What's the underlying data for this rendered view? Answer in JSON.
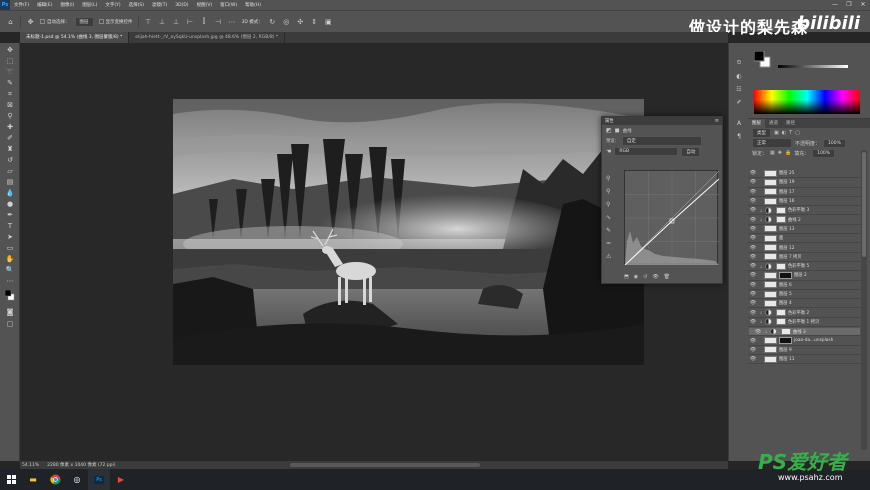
{
  "menu": {
    "app_logo": "Ps",
    "items": [
      "文件(F)",
      "编辑(E)",
      "图像(I)",
      "图层(L)",
      "文字(Y)",
      "选择(S)",
      "滤镜(T)",
      "3D(D)",
      "视图(V)",
      "窗口(W)",
      "帮助(H)"
    ],
    "window_controls": [
      "—",
      "❐",
      "✕"
    ]
  },
  "options": {
    "auto_select_label": "自动选择：",
    "auto_select_value": "图层",
    "show_transform_label": "显示变换控件",
    "mode_3d_label": "3D 模式："
  },
  "watermark": {
    "text": "做设计的梨先森",
    "brand": "bilibili"
  },
  "tabs": [
    {
      "label": "未标题-1.psd @ 54.1% (曲线 3, 图层蒙版/8) *",
      "active": true
    },
    {
      "label": "elijah-hiett-_rV_oySqkU-unsplash.jpg @ 48.6% (图层 2, RGB/8) *",
      "active": false
    }
  ],
  "status": {
    "zoom": "54.11%",
    "doc_info": "2280 像素 x 1040 像素 (72 ppi)"
  },
  "properties": {
    "title": "属性",
    "type_label": "曲线",
    "preset_label": "预设：",
    "preset_value": "自定",
    "channel_value": "RGB",
    "auto_button": "自动"
  },
  "layers": {
    "tabs": [
      "图层",
      "通道",
      "路径"
    ],
    "kind_filter": "类型",
    "blend_mode": "正常",
    "opacity_label": "不透明度：",
    "opacity_value": "100%",
    "lock_label": "锁定：",
    "fill_label": "填充：",
    "fill_value": "100%",
    "items": [
      {
        "name": "图层 25",
        "kind": "pixel",
        "selected": false
      },
      {
        "name": "图层 19",
        "kind": "pixel",
        "selected": false
      },
      {
        "name": "图层 17",
        "kind": "pixel",
        "selected": false
      },
      {
        "name": "图层 16",
        "kind": "pixel",
        "selected": false
      },
      {
        "name": "色彩平衡 3",
        "kind": "adj",
        "selected": false
      },
      {
        "name": "曲线 2",
        "kind": "adj",
        "selected": false
      },
      {
        "name": "图层 13",
        "kind": "pixel",
        "selected": false
      },
      {
        "name": "鹿",
        "kind": "pixel",
        "selected": false
      },
      {
        "name": "图层 12",
        "kind": "pixel",
        "selected": false
      },
      {
        "name": "图层 7 拷贝",
        "kind": "pixel",
        "selected": false
      },
      {
        "name": "色彩平衡 5",
        "kind": "adj",
        "selected": false
      },
      {
        "name": "图层 2",
        "kind": "mask",
        "selected": false
      },
      {
        "name": "图层 6",
        "kind": "pixel",
        "selected": false
      },
      {
        "name": "图层 5",
        "kind": "pixel",
        "selected": false
      },
      {
        "name": "图层 4",
        "kind": "pixel",
        "selected": false
      },
      {
        "name": "色彩平衡 2",
        "kind": "adj",
        "selected": false
      },
      {
        "name": "色彩平衡 1 拷贝",
        "kind": "adj",
        "selected": false
      },
      {
        "name": "曲线 3",
        "kind": "adj",
        "selected": true
      },
      {
        "name": "joao-da...unsplash",
        "kind": "mask",
        "selected": false
      },
      {
        "name": "图层 9",
        "kind": "pixel",
        "selected": false
      },
      {
        "name": "图层 11",
        "kind": "pixel",
        "selected": false
      }
    ]
  },
  "site_logo": {
    "text": "PS爱好者",
    "url": "www.psahz.com"
  },
  "colors": {
    "accent": "#31a8ff",
    "ui_bg": "#535353",
    "canvas_bg": "#282828"
  }
}
